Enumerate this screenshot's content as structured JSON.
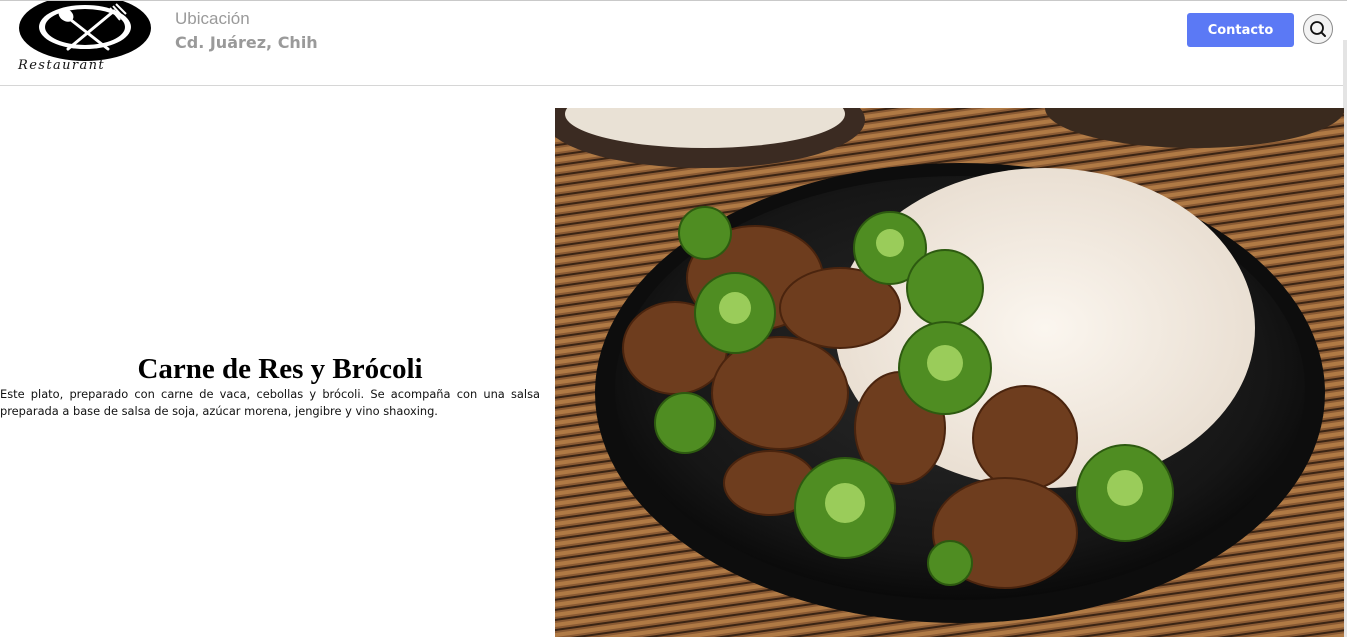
{
  "header": {
    "logo_text": "Restaurant",
    "location_label": "Ubicación",
    "location_value": "Cd. Juárez, Chih",
    "contact_label": "Contacto",
    "search_icon": "search-icon"
  },
  "dish": {
    "title": "Carne de Res y Brócoli",
    "description": "Este plato, preparado con carne de vaca, cebollas y brócoli. Se acompaña con una salsa preparada a base de salsa de soja, azúcar morena, jengibre y vino shaoxing."
  },
  "colors": {
    "accent": "#5b79f5",
    "muted_text": "#9a9a9a"
  }
}
